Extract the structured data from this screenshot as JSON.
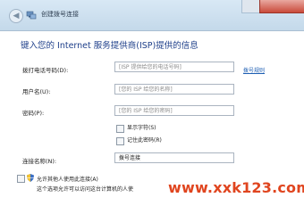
{
  "window": {
    "title": "创建拨号连接",
    "back_glyph": "◀"
  },
  "heading": "键入您的 Internet 服务提供商(ISP)提供的信息",
  "form": {
    "phone_label": "拨打电话号码(D):",
    "phone_placeholder": "[ISP 提供给您的电话号码]",
    "dialing_rules_link": "拨号规则",
    "username_label": "用户名(U):",
    "username_placeholder": "[您的 ISP 给您的名称]",
    "password_label": "密码(P):",
    "password_placeholder": "[您的 ISP 给您的密码]",
    "show_chars_label": "显示字符(S)",
    "remember_pw_label": "记住此密码(R)",
    "connection_name_label": "连接名称(N):",
    "connection_name_value": "拨号连接"
  },
  "sharing": {
    "allow_label": "允许其他人使用此连接(A)",
    "note": "这个选项允许可以访问这台计算机的人使"
  },
  "watermark": "www.xxk123.com",
  "colors": {
    "heading": "#1e3f8a",
    "link": "#1e5fb3",
    "watermark": "#e0451f"
  }
}
